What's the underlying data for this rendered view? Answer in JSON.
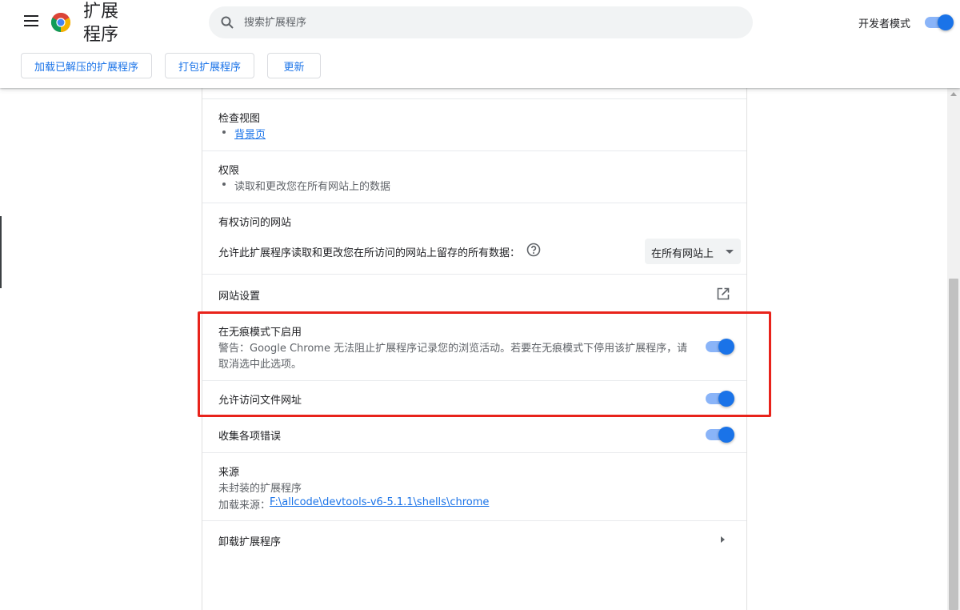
{
  "header": {
    "title": "扩展程序",
    "search_placeholder": "搜索扩展程序",
    "dev_mode_label": "开发者模式",
    "dev_mode_on": true
  },
  "toolbar": {
    "load_unpacked": "加载已解压的扩展程序",
    "pack": "打包扩展程序",
    "update": "更新"
  },
  "details": {
    "inspect_views": {
      "heading": "检查视图",
      "link": "背景页"
    },
    "permissions": {
      "heading": "权限",
      "item": "读取和更改您在所有网站上的数据"
    },
    "site_access": {
      "heading": "有权访问的网站",
      "description": "允许此扩展程序读取和更改您在所访问的网站上留存的所有数据：",
      "selected": "在所有网站上"
    },
    "site_settings": "网站设置",
    "incognito": {
      "heading": "在无痕模式下启用",
      "warning_line1": "警告：Google Chrome 无法阻止扩展程序记录您的浏览活动。若要在无痕模式下停用该扩展程序，请",
      "warning_line2": "取消选中此选项。",
      "enabled": true
    },
    "file_urls": {
      "label": "允许访问文件网址",
      "enabled": true
    },
    "collect_errors": {
      "label": "收集各项错误",
      "enabled": true
    },
    "source": {
      "heading": "来源",
      "type": "未封装的扩展程序",
      "loaded_from_label": "加载来源：",
      "path": " F:\\allcode\\devtools-v6-5.1.1\\shells\\chrome"
    },
    "remove": "卸载扩展程序"
  },
  "colors": {
    "accent": "#1a73e8",
    "toggle_track": "#8ab4f8",
    "highlight": "#e8231b"
  }
}
